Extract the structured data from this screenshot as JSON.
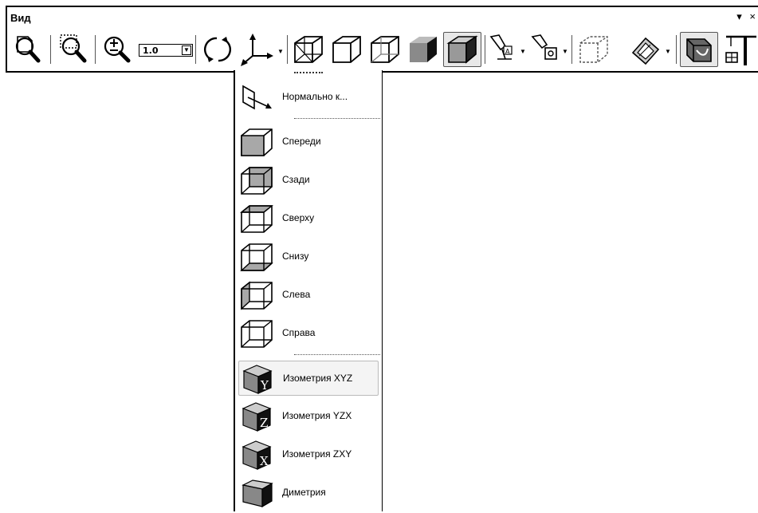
{
  "panel": {
    "title": "Вид",
    "controls": "▾ ×"
  },
  "toolbar": {
    "zoom_value": "1.0",
    "tools": [
      {
        "name": "zoom-page-icon"
      },
      {
        "name": "zoom-frame-icon"
      },
      {
        "name": "zoom-in-out-icon"
      },
      {
        "name": "rotate-icon"
      },
      {
        "name": "orientation-icon"
      },
      {
        "name": "wireframe-icon"
      },
      {
        "name": "hidden-lines-icon"
      },
      {
        "name": "thin-lines-icon"
      },
      {
        "name": "shaded-icon"
      },
      {
        "name": "shaded-edges-icon"
      },
      {
        "name": "light-source-icon"
      },
      {
        "name": "camera-icon"
      },
      {
        "name": "dashed-box-icon"
      },
      {
        "name": "section-icon"
      },
      {
        "name": "perspective-icon"
      },
      {
        "name": "crane-icon"
      }
    ]
  },
  "orientation_menu": {
    "normal_to": "Нормально к...",
    "items": [
      {
        "label": "Спереди",
        "icon": "cube-front-icon"
      },
      {
        "label": "Сзади",
        "icon": "cube-back-icon"
      },
      {
        "label": "Сверху",
        "icon": "cube-top-icon"
      },
      {
        "label": "Снизу",
        "icon": "cube-bottom-icon"
      },
      {
        "label": "Слева",
        "icon": "cube-left-icon"
      },
      {
        "label": "Справа",
        "icon": "cube-right-icon"
      }
    ],
    "iso_items": [
      {
        "label": "Изометрия XYZ",
        "axis": "Y",
        "icon": "iso-xyz-icon"
      },
      {
        "label": "Изометрия YZX",
        "axis": "Z",
        "icon": "iso-yzx-icon"
      },
      {
        "label": "Изометрия ZXY",
        "axis": "X",
        "icon": "iso-zxy-icon"
      }
    ],
    "dimetry": {
      "label": "Диметрия",
      "icon": "dimetry-icon"
    }
  }
}
